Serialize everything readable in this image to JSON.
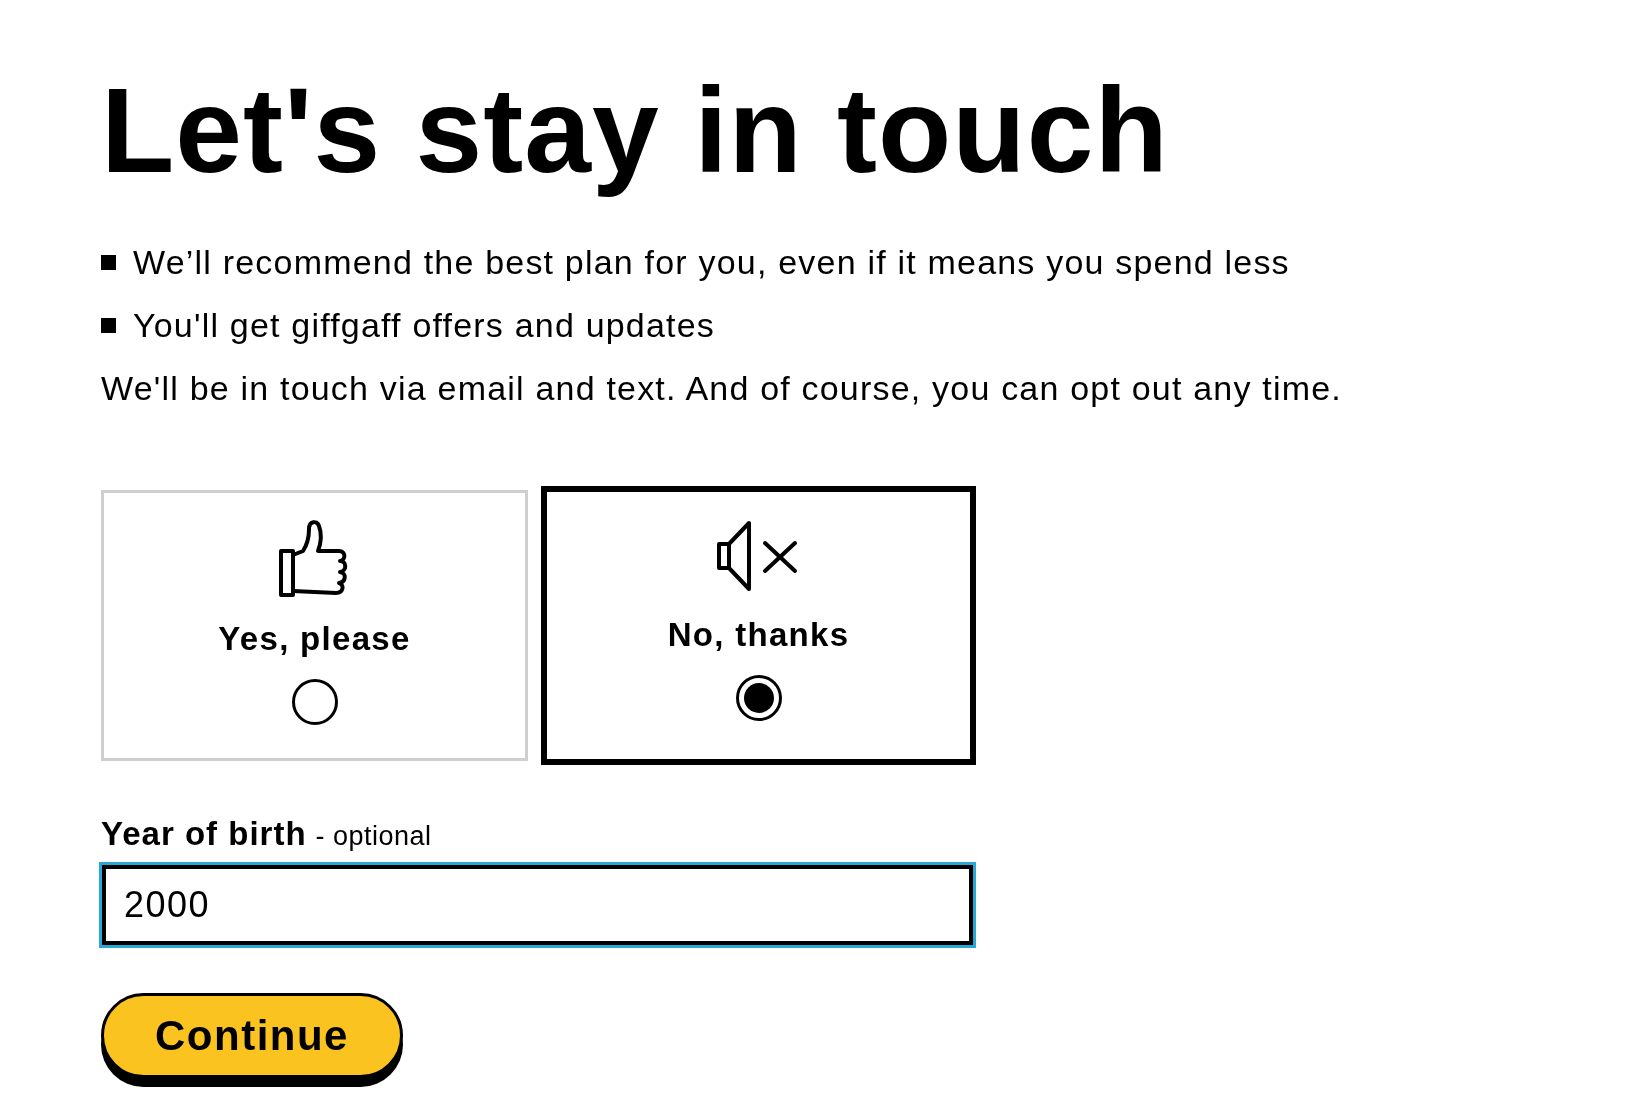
{
  "heading": "Let's stay in touch",
  "benefits": [
    "We’ll recommend the best plan for you, even if it means you spend less",
    "You'll get giffgaff offers and updates"
  ],
  "note": "We'll be in touch via email and text. And of course, you can opt out any time.",
  "options": [
    {
      "kind": "thumbs-up",
      "label": "Yes, please",
      "selected": false
    },
    {
      "kind": "mute",
      "label": "No, thanks",
      "selected": true
    }
  ],
  "year_field": {
    "label": "Year of birth",
    "hint": "- optional",
    "value": "2000",
    "focused": true
  },
  "continue_button": "Continue"
}
